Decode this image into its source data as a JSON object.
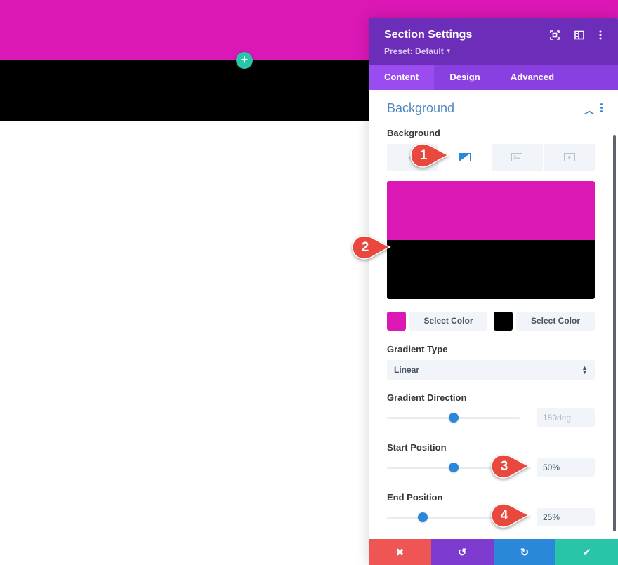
{
  "colors": {
    "magenta": "#db17b6",
    "black": "#000000",
    "header_purple": "#6c2eb9",
    "tab_purple": "#8a3fe0",
    "tab_active": "#9a4cf0",
    "accent_blue": "#2b87da",
    "title_blue": "#4f87c2",
    "field_bg": "#f1f5f9",
    "add_green": "#29c4a9",
    "footer_red": "#ef5555",
    "footer_purple": "#7e3bd0",
    "footer_blue": "#2b87da",
    "footer_green": "#29c4a9",
    "badge_red": "#e8483d",
    "scrollbar": "#5c6270"
  },
  "canvas": {
    "add_button_label": "+"
  },
  "panel": {
    "title": "Section Settings",
    "preset": "Preset: Default",
    "header_icons": [
      "fullscreen-icon",
      "split-view-icon",
      "more-options-icon"
    ],
    "tabs": [
      {
        "label": "Content",
        "active": true
      },
      {
        "label": "Design",
        "active": false
      },
      {
        "label": "Advanced",
        "active": false
      }
    ],
    "group": {
      "title": "Background",
      "collapsed": false
    },
    "background": {
      "label": "Background",
      "tabs": [
        {
          "icon": "color-icon",
          "active": false
        },
        {
          "icon": "gradient-icon",
          "active": true
        },
        {
          "icon": "image-icon",
          "active": false
        },
        {
          "icon": "video-icon",
          "active": false
        }
      ],
      "gradient_stops": [
        {
          "color": "#db17b6",
          "label": "Select Color"
        },
        {
          "color": "#000000",
          "label": "Select Color"
        }
      ]
    },
    "gradient_type": {
      "label": "Gradient Type",
      "value": "Linear"
    },
    "gradient_direction": {
      "label": "Gradient Direction",
      "value": "180deg",
      "fraction": 0.5
    },
    "start_position": {
      "label": "Start Position",
      "value": "50%",
      "fraction": 0.5
    },
    "end_position": {
      "label": "End Position",
      "value": "25%",
      "fraction": 0.27
    },
    "footer": [
      {
        "name": "discard-button",
        "icon": "close-icon",
        "glyph": "✖"
      },
      {
        "name": "undo-button",
        "icon": "undo-icon",
        "glyph": "↺"
      },
      {
        "name": "redo-button",
        "icon": "redo-icon",
        "glyph": "↻"
      },
      {
        "name": "save-button",
        "icon": "check-icon",
        "glyph": "✔"
      }
    ]
  },
  "annotations": [
    "1",
    "2",
    "3",
    "4"
  ]
}
